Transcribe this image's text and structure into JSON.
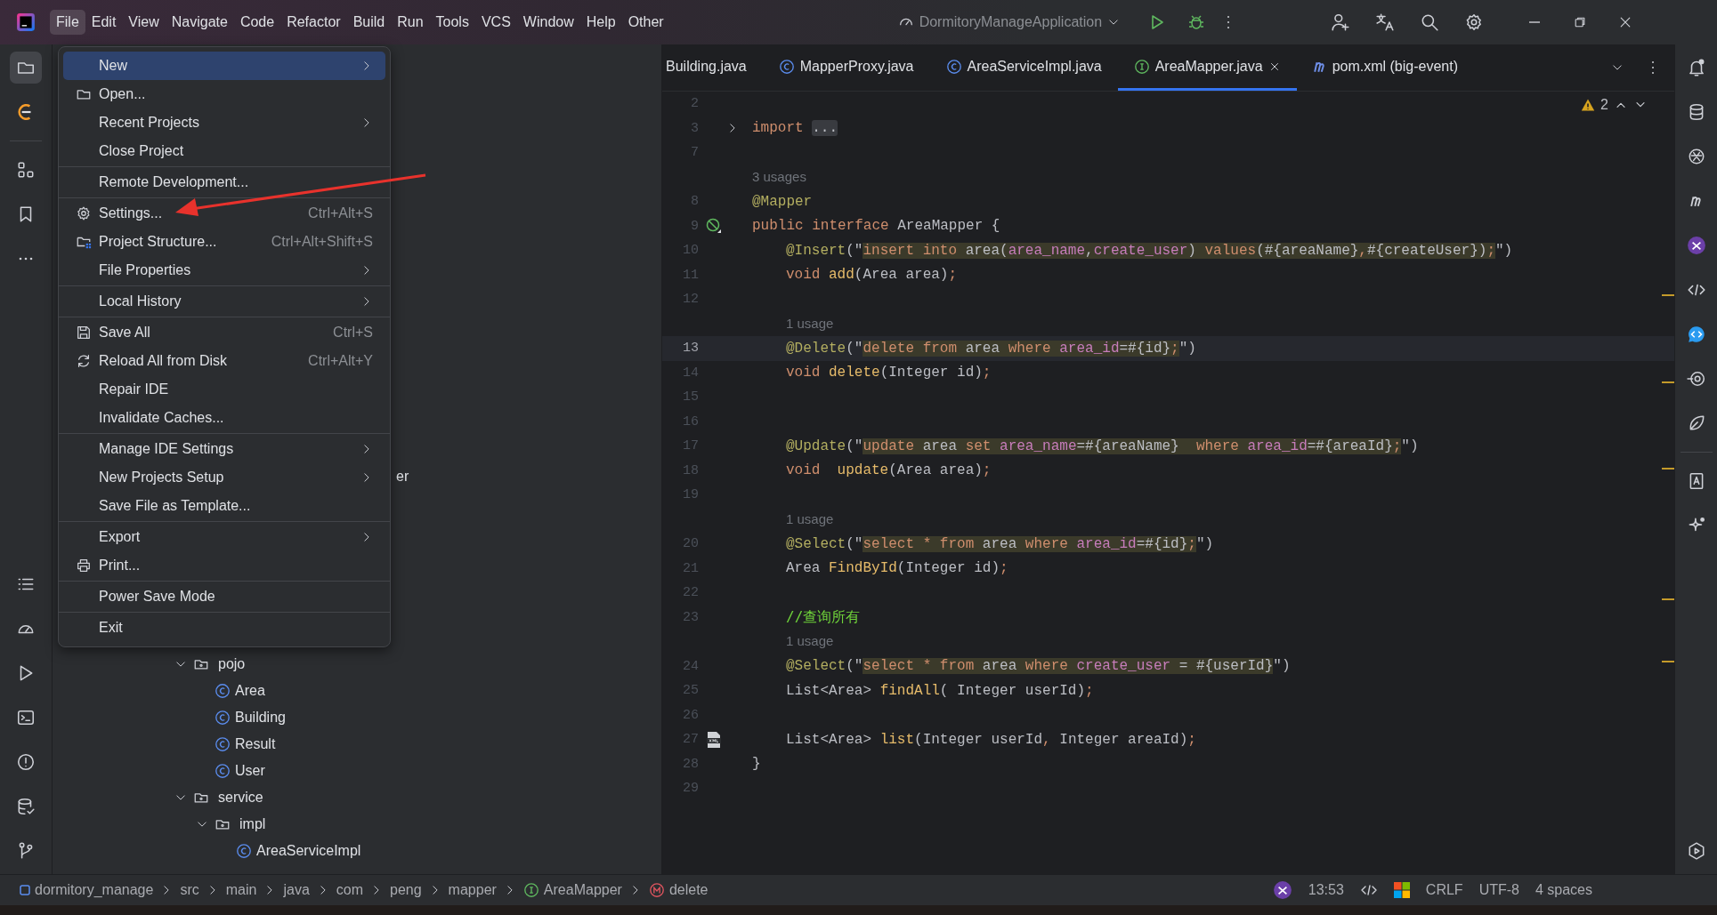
{
  "title_bar": {
    "menu": [
      {
        "label": "File",
        "selected": true
      },
      {
        "label": "Edit",
        "selected": false
      },
      {
        "label": "View",
        "selected": false
      },
      {
        "label": "Navigate",
        "selected": false
      },
      {
        "label": "Code",
        "selected": false
      },
      {
        "label": "Refactor",
        "selected": false
      },
      {
        "label": "Build",
        "selected": false
      },
      {
        "label": "Run",
        "selected": false
      },
      {
        "label": "Tools",
        "selected": false
      },
      {
        "label": "VCS",
        "selected": false
      },
      {
        "label": "Window",
        "selected": false
      },
      {
        "label": "Help",
        "selected": false
      },
      {
        "label": "Other",
        "selected": false
      }
    ],
    "run_configuration": "DormitoryManageApplication"
  },
  "file_menu": [
    [
      {
        "label": "New",
        "submenu": true,
        "selected": true
      },
      {
        "label": "Open...",
        "submenu": false,
        "selected": false
      },
      {
        "label": "Recent Projects",
        "submenu": true,
        "selected": false
      },
      {
        "label": "Close Project",
        "submenu": false,
        "selected": false
      }
    ],
    [
      {
        "label": "Remote Development...",
        "submenu": false,
        "selected": false
      }
    ],
    [
      {
        "label": "Settings...",
        "shortcut": "Ctrl+Alt+S",
        "submenu": false,
        "selected": false
      },
      {
        "label": "Project Structure...",
        "shortcut": "Ctrl+Alt+Shift+S",
        "submenu": false,
        "selected": false
      },
      {
        "label": "File Properties",
        "submenu": true,
        "selected": false
      }
    ],
    [
      {
        "label": "Local History",
        "submenu": true,
        "selected": false
      }
    ],
    [
      {
        "label": "Save All",
        "shortcut": "Ctrl+S",
        "submenu": false,
        "selected": false
      },
      {
        "label": "Reload All from Disk",
        "shortcut": "Ctrl+Alt+Y",
        "submenu": false,
        "selected": false
      },
      {
        "label": "Repair IDE",
        "submenu": false,
        "selected": false
      },
      {
        "label": "Invalidate Caches...",
        "submenu": false,
        "selected": false
      }
    ],
    [
      {
        "label": "Manage IDE Settings",
        "submenu": true,
        "selected": false
      },
      {
        "label": "New Projects Setup",
        "submenu": true,
        "selected": false
      },
      {
        "label": "Save File as Template...",
        "submenu": false,
        "selected": false
      }
    ],
    [
      {
        "label": "Export",
        "submenu": true,
        "selected": false
      },
      {
        "label": "Print...",
        "submenu": false,
        "selected": false
      }
    ],
    [
      {
        "label": "Power Save Mode",
        "submenu": false,
        "selected": false
      }
    ],
    [
      {
        "label": "Exit",
        "submenu": false,
        "selected": false
      }
    ]
  ],
  "project_tree": {
    "partial_row": "er",
    "items": [
      {
        "label": "pojo",
        "kind": "package",
        "expanded": true,
        "children": [
          {
            "label": "Area",
            "kind": "class"
          },
          {
            "label": "Building",
            "kind": "class"
          },
          {
            "label": "Result",
            "kind": "class"
          },
          {
            "label": "User",
            "kind": "class"
          }
        ]
      },
      {
        "label": "service",
        "kind": "package",
        "expanded": true,
        "children": [
          {
            "label": "impl",
            "kind": "package",
            "expanded": true,
            "children": [
              {
                "label": "AreaServiceImpl",
                "kind": "class"
              }
            ]
          }
        ]
      }
    ]
  },
  "tabs": [
    {
      "label": "Building.java",
      "kind": "plain",
      "selected": false
    },
    {
      "label": "MapperProxy.java",
      "kind": "class",
      "selected": false
    },
    {
      "label": "AreaServiceImpl.java",
      "kind": "class",
      "selected": false
    },
    {
      "label": "AreaMapper.java",
      "kind": "interface",
      "selected": true
    },
    {
      "label": "pom.xml (big-event)",
      "kind": "maven",
      "selected": false
    }
  ],
  "editor": {
    "warnings": "2",
    "lines": [
      {
        "n": "2",
        "kind": "code"
      },
      {
        "n": "3",
        "kind": "code",
        "folded": true,
        "tokens": [
          {
            "kind": "keyword",
            "text": "import "
          },
          {
            "kind": "folded",
            "text": "..."
          }
        ]
      },
      {
        "n": "7",
        "kind": "code"
      },
      {
        "kind": "hint",
        "hint": "3 usages",
        "indented": false
      },
      {
        "n": "8",
        "kind": "code",
        "tokens": [
          {
            "kind": "annotation",
            "text": "@Mapper"
          }
        ]
      },
      {
        "n": "9",
        "kind": "implemented",
        "tokens": [
          {
            "kind": "keyword",
            "text": "public interface "
          },
          {
            "kind": "plain",
            "text": "AreaMapper {"
          }
        ]
      },
      {
        "n": "10",
        "kind": "code",
        "indented": true,
        "tokens": [
          {
            "kind": "annotation",
            "text": "@Insert"
          },
          {
            "kind": "plain",
            "text": "(\""
          },
          {
            "kind": "sqlkeyword",
            "text": "insert into "
          },
          {
            "kind": "sqltext",
            "text": "area("
          },
          {
            "kind": "sqlcolumn",
            "text": "area_name"
          },
          {
            "kind": "sqltext",
            "text": ","
          },
          {
            "kind": "sqlcolumn",
            "text": "create_user"
          },
          {
            "kind": "sqltext",
            "text": ") "
          },
          {
            "kind": "sqlkeyword",
            "text": "values"
          },
          {
            "kind": "sqltext",
            "text": "(#{areaName}"
          },
          {
            "kind": "sqlkeyword",
            "text": ","
          },
          {
            "kind": "sqltext",
            "text": "#{createUser})"
          },
          {
            "kind": "sqlkeyword",
            "text": ";"
          },
          {
            "kind": "plain",
            "text": "\")"
          }
        ]
      },
      {
        "n": "11",
        "kind": "code",
        "indented": true,
        "tokens": [
          {
            "kind": "keyword",
            "text": "void "
          },
          {
            "kind": "method",
            "text": "add"
          },
          {
            "kind": "plain",
            "text": "(Area area)"
          },
          {
            "kind": "keyword",
            "text": ";"
          }
        ]
      },
      {
        "n": "12",
        "kind": "code"
      },
      {
        "kind": "hint",
        "hint": "1 usage",
        "indented": true
      },
      {
        "n": "13",
        "kind": "code",
        "current": true,
        "indented": true,
        "tokens": [
          {
            "kind": "annotation",
            "text": "@Delete"
          },
          {
            "kind": "plain",
            "text": "(\""
          },
          {
            "kind": "sqlkeyword",
            "text": "delete from "
          },
          {
            "kind": "sqltext",
            "text": "area "
          },
          {
            "kind": "sqlkeyword",
            "text": "where "
          },
          {
            "kind": "sqlcolumn",
            "text": "area_id"
          },
          {
            "kind": "sqltext",
            "text": "=#{id}"
          },
          {
            "kind": "sqlkeyword",
            "text": ";"
          },
          {
            "kind": "plain",
            "text": "\")"
          }
        ]
      },
      {
        "n": "14",
        "kind": "code",
        "indented": true,
        "tokens": [
          {
            "kind": "keyword",
            "text": "void "
          },
          {
            "kind": "method",
            "text": "delete"
          },
          {
            "kind": "plain",
            "text": "(Integer id)"
          },
          {
            "kind": "keyword",
            "text": ";"
          }
        ]
      },
      {
        "n": "15",
        "kind": "code"
      },
      {
        "n": "16",
        "kind": "code"
      },
      {
        "n": "17",
        "kind": "code",
        "indented": true,
        "tokens": [
          {
            "kind": "annotation",
            "text": "@Update"
          },
          {
            "kind": "plain",
            "text": "(\""
          },
          {
            "kind": "sqlkeyword",
            "text": "update "
          },
          {
            "kind": "sqltext",
            "text": "area "
          },
          {
            "kind": "sqlkeyword",
            "text": "set "
          },
          {
            "kind": "sqlcolumn",
            "text": "area_name"
          },
          {
            "kind": "sqltext",
            "text": "=#{areaName}  "
          },
          {
            "kind": "sqlkeyword",
            "text": "where "
          },
          {
            "kind": "sqlcolumn",
            "text": "area_id"
          },
          {
            "kind": "sqltext",
            "text": "=#{areaId}"
          },
          {
            "kind": "sqlkeyword",
            "text": ";"
          },
          {
            "kind": "plain",
            "text": "\")"
          }
        ]
      },
      {
        "n": "18",
        "kind": "code",
        "indented": true,
        "tokens": [
          {
            "kind": "keyword",
            "text": "void  "
          },
          {
            "kind": "method",
            "text": "update"
          },
          {
            "kind": "plain",
            "text": "(Area area)"
          },
          {
            "kind": "keyword",
            "text": ";"
          }
        ]
      },
      {
        "n": "19",
        "kind": "code"
      },
      {
        "kind": "hint",
        "hint": "1 usage",
        "indented": true
      },
      {
        "n": "20",
        "kind": "code",
        "indented": true,
        "tokens": [
          {
            "kind": "annotation",
            "text": "@Select"
          },
          {
            "kind": "plain",
            "text": "(\""
          },
          {
            "kind": "sqlkeyword",
            "text": "select * from "
          },
          {
            "kind": "sqltext",
            "text": "area "
          },
          {
            "kind": "sqlkeyword",
            "text": "where "
          },
          {
            "kind": "sqlcolumn",
            "text": "area_id"
          },
          {
            "kind": "sqltext",
            "text": "=#{id}"
          },
          {
            "kind": "sqlkeyword",
            "text": ";"
          },
          {
            "kind": "plain",
            "text": "\")"
          }
        ]
      },
      {
        "n": "21",
        "kind": "code",
        "indented": true,
        "tokens": [
          {
            "kind": "plain",
            "text": "Area "
          },
          {
            "kind": "method",
            "text": "FindById"
          },
          {
            "kind": "plain",
            "text": "(Integer id)"
          },
          {
            "kind": "keyword",
            "text": ";"
          }
        ]
      },
      {
        "n": "22",
        "kind": "code"
      },
      {
        "n": "23",
        "kind": "code",
        "indented": true,
        "tokens": [
          {
            "kind": "comment",
            "text": "//查询所有"
          }
        ]
      },
      {
        "kind": "hint",
        "hint": "1 usage",
        "indented": true
      },
      {
        "n": "24",
        "kind": "code",
        "indented": true,
        "tokens": [
          {
            "kind": "annotation",
            "text": "@Select"
          },
          {
            "kind": "plain",
            "text": "(\""
          },
          {
            "kind": "sqlkeyword",
            "text": "select * from "
          },
          {
            "kind": "sqltext",
            "text": "area "
          },
          {
            "kind": "sqlkeyword",
            "text": "where "
          },
          {
            "kind": "sqlcolumn",
            "text": "create_user"
          },
          {
            "kind": "sqltext",
            "text": " = #{userId}"
          },
          {
            "kind": "plain",
            "text": "\")"
          }
        ]
      },
      {
        "n": "25",
        "kind": "code",
        "indented": true,
        "tokens": [
          {
            "kind": "plain",
            "text": "List<Area> "
          },
          {
            "kind": "method",
            "text": "findAll"
          },
          {
            "kind": "plain",
            "text": "( Integer userId)"
          },
          {
            "kind": "keyword",
            "text": ";"
          }
        ]
      },
      {
        "n": "26",
        "kind": "code"
      },
      {
        "n": "27",
        "kind": "mapped",
        "indented": true,
        "tokens": [
          {
            "kind": "plain",
            "text": "List<Area> "
          },
          {
            "kind": "method",
            "text": "list"
          },
          {
            "kind": "plain",
            "text": "(Integer userId"
          },
          {
            "kind": "keyword",
            "text": ","
          },
          {
            "kind": "plain",
            "text": " Integer areaId)"
          },
          {
            "kind": "keyword",
            "text": ";"
          }
        ]
      },
      {
        "n": "28",
        "kind": "code",
        "tokens": [
          {
            "kind": "plain",
            "text": "}"
          }
        ]
      },
      {
        "n": "29",
        "kind": "code"
      }
    ]
  },
  "status_bar": {
    "breadcrumbs": [
      {
        "label": "dormitory_manage",
        "kind": "module"
      },
      {
        "label": "src",
        "kind": "folder"
      },
      {
        "label": "main",
        "kind": "folder"
      },
      {
        "label": "java",
        "kind": "folder"
      },
      {
        "label": "com",
        "kind": "folder"
      },
      {
        "label": "peng",
        "kind": "folder"
      },
      {
        "label": "mapper",
        "kind": "folder"
      },
      {
        "label": "AreaMapper",
        "kind": "interface"
      },
      {
        "label": "delete",
        "kind": "method"
      }
    ],
    "position": "13:53",
    "line_separator": "CRLF",
    "encoding": "UTF-8",
    "indent": "4 spaces"
  }
}
